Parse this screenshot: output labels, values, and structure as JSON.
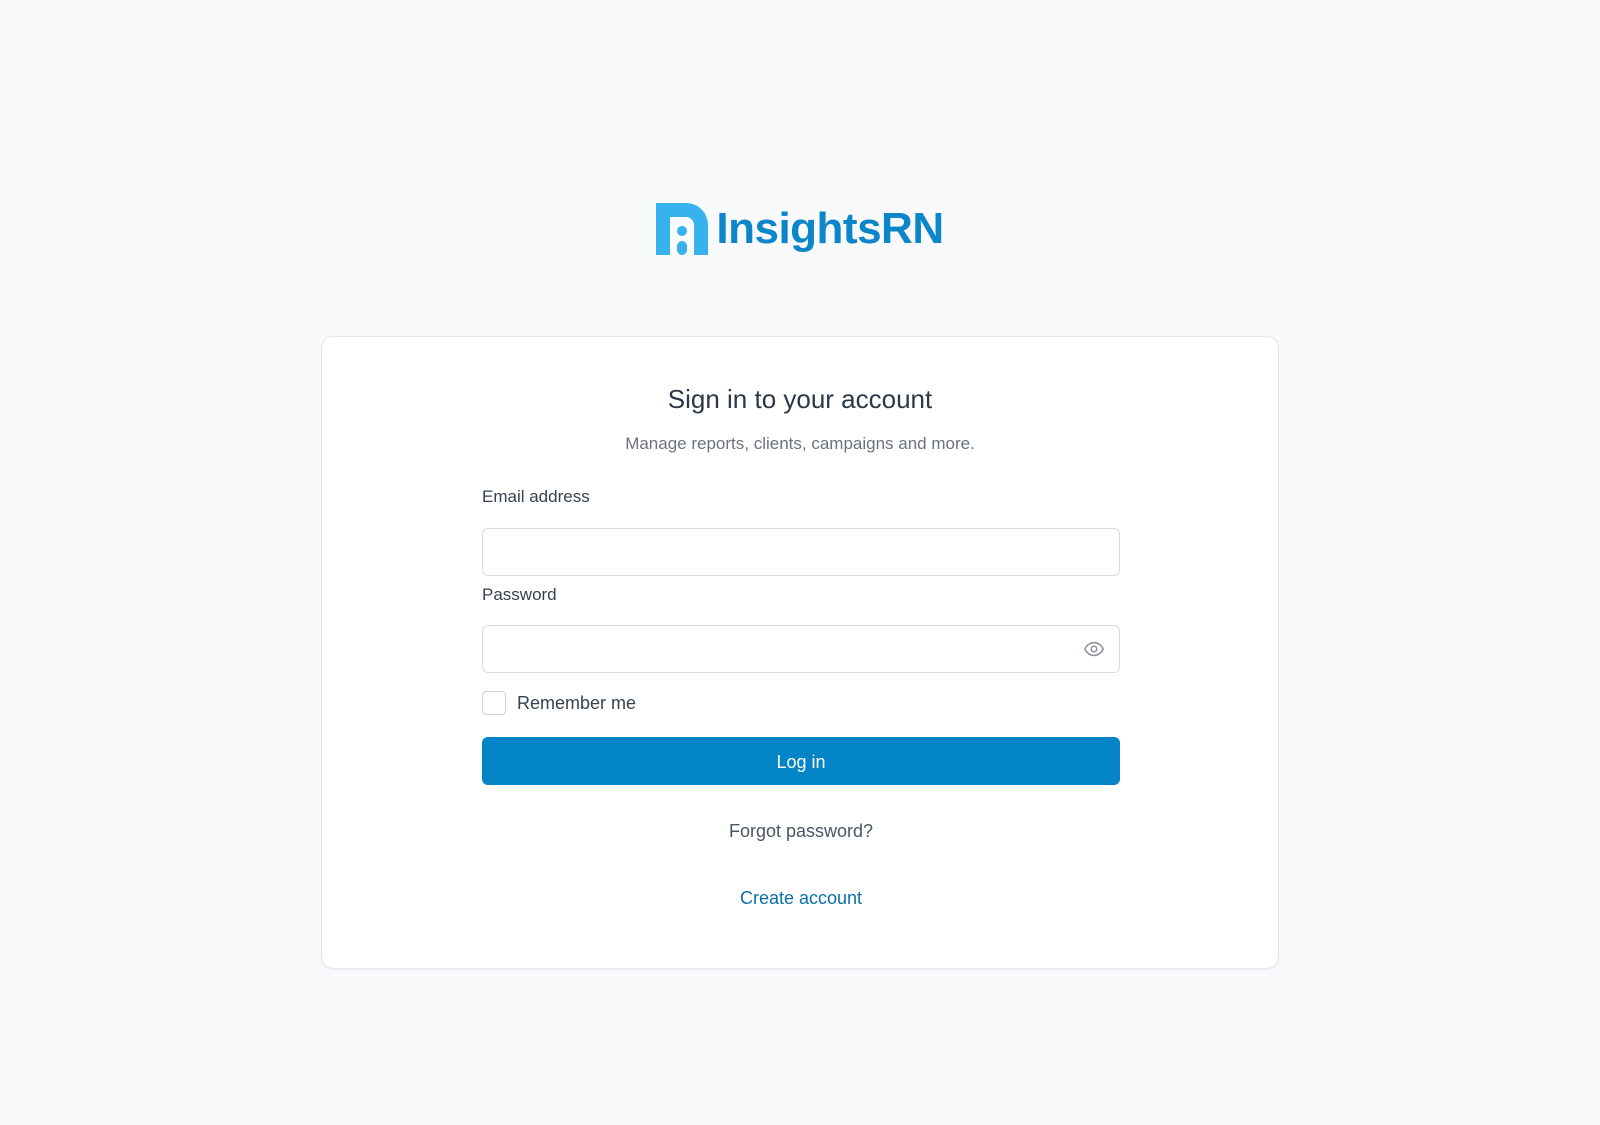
{
  "brand": {
    "name": "InsightsRN",
    "colors": {
      "mark": "#38b2ec",
      "wordmark": "#0b86c8",
      "primary": "#0284c7",
      "link": "#0a6fa8",
      "background": "#f8fafc"
    },
    "logo_icon": "insightsrn-logo-mark"
  },
  "login": {
    "title": "Sign in to your account",
    "subtitle": "Manage reports, clients, campaigns and more.",
    "email": {
      "label": "Email address",
      "value": "",
      "placeholder": ""
    },
    "password": {
      "label": "Password",
      "value": "",
      "placeholder": "",
      "toggle_icon": "eye-icon"
    },
    "remember_me": {
      "label": "Remember me",
      "checked": false
    },
    "submit_label": "Log in",
    "forgot_password": "Forgot password?",
    "create_account": "Create account"
  }
}
